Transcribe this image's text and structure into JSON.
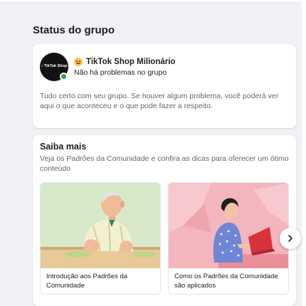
{
  "status_section": {
    "title": "Status do grupo",
    "avatar_text": "♪ TikTok Shop",
    "group_emoji_icon": "money-face-icon",
    "group_name": "TikTok Shop Milionário",
    "group_status": "Não há problemas no grupo",
    "body": "Tudo certo com seu grupo. Se houver algum problema, você poderá ver aqui o que aconteceu e o que pode fazer a respeito."
  },
  "learn_more": {
    "title": "Saiba mais",
    "description": "Veja os Padrões da Comunidade e confira as dicas para oferecer um ótimo conteúdo",
    "tiles": [
      {
        "caption": "Introdução aos Padrões da Comunidade",
        "image": "elderly-man-illustration"
      },
      {
        "caption": "Como os Padrões da Comunidade são aplicados",
        "image": "woman-laptop-illustration"
      }
    ],
    "next_icon": "chevron-right-icon"
  },
  "colors": {
    "background": "#f0f2f5",
    "card": "#ffffff",
    "online": "#31a24c",
    "secondary_text": "#65676b"
  }
}
